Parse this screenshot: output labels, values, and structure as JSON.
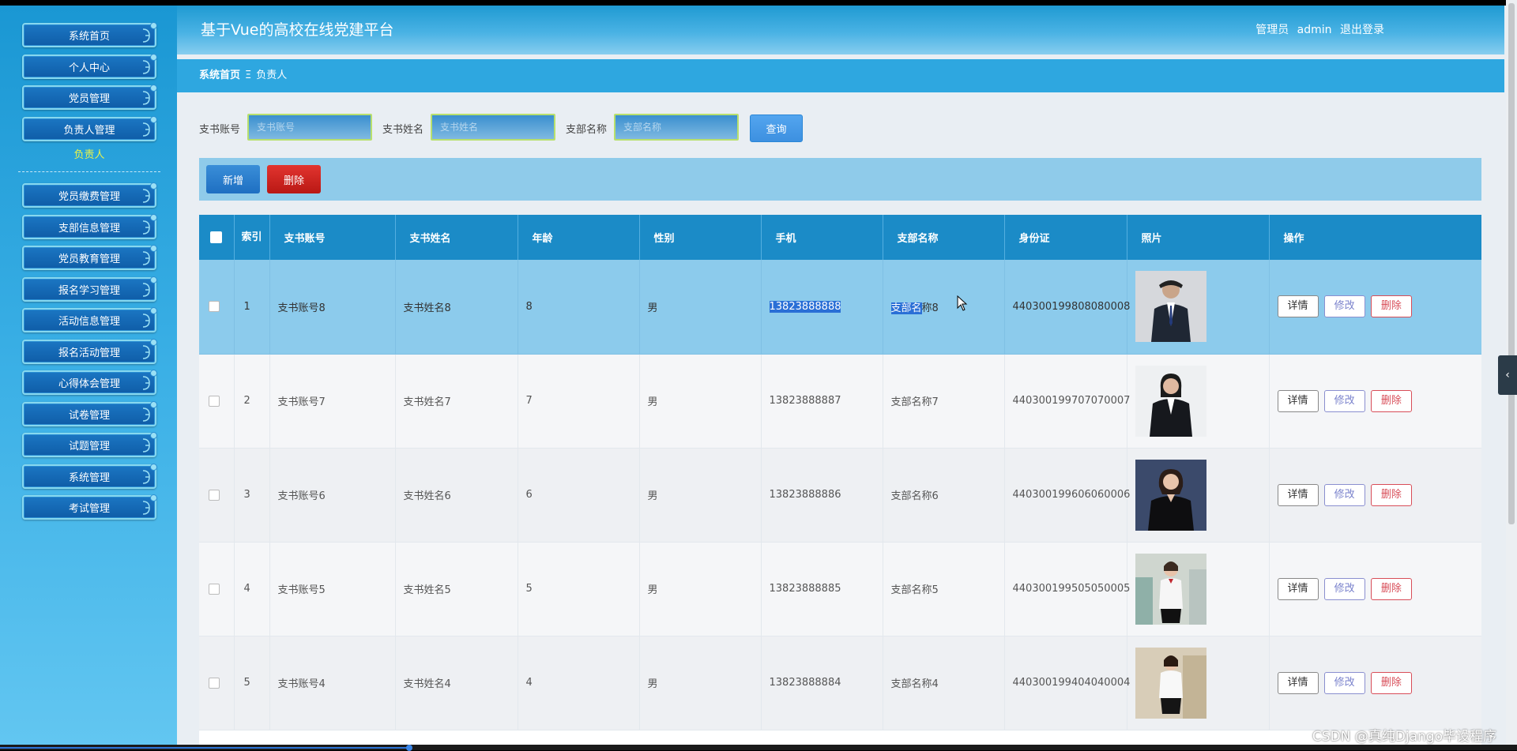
{
  "header": {
    "title": "基于Vue的高校在线党建平台",
    "user_role": "管理员",
    "user_name": "admin",
    "logout_label": "退出登录"
  },
  "sidebar": {
    "items": [
      {
        "label": "系统首页"
      },
      {
        "label": "个人中心"
      },
      {
        "label": "党员管理"
      },
      {
        "label": "负责人管理"
      }
    ],
    "active_subitem": "负责人",
    "items_after": [
      {
        "label": "党员缴费管理"
      },
      {
        "label": "支部信息管理"
      },
      {
        "label": "党员教育管理"
      },
      {
        "label": "报名学习管理"
      },
      {
        "label": "活动信息管理"
      },
      {
        "label": "报名活动管理"
      },
      {
        "label": "心得体会管理"
      },
      {
        "label": "试卷管理"
      },
      {
        "label": "试题管理"
      },
      {
        "label": "系统管理"
      },
      {
        "label": "考试管理"
      }
    ]
  },
  "breadcrumb": {
    "home": "系统首页",
    "separator": "Ξ",
    "current": "负责人"
  },
  "search": {
    "field1_label": "支书账号",
    "field1_placeholder": "支书账号",
    "field2_label": "支书姓名",
    "field2_placeholder": "支书姓名",
    "field3_label": "支部名称",
    "field3_placeholder": "支部名称",
    "query_label": "查询"
  },
  "actions": {
    "add_label": "新增",
    "delete_label": "删除"
  },
  "table": {
    "headers": {
      "index": "索引",
      "account": "支书账号",
      "name": "支书姓名",
      "age": "年龄",
      "gender": "性别",
      "phone": "手机",
      "branch": "支部名称",
      "id_card": "身份证",
      "photo": "照片",
      "ops": "操作"
    },
    "op_labels": {
      "detail": "详情",
      "edit": "修改",
      "delete": "删除"
    },
    "rows": [
      {
        "index": "1",
        "account": "支书账号8",
        "name": "支书姓名8",
        "age": "8",
        "gender": "男",
        "phone": "13823888888",
        "branch_selected_part": "支部名",
        "branch_rest": "称8",
        "id_card": "440300199808080008"
      },
      {
        "index": "2",
        "account": "支书账号7",
        "name": "支书姓名7",
        "age": "7",
        "gender": "男",
        "phone": "13823888887",
        "branch": "支部名称7",
        "id_card": "440300199707070007"
      },
      {
        "index": "3",
        "account": "支书账号6",
        "name": "支书姓名6",
        "age": "6",
        "gender": "男",
        "phone": "13823888886",
        "branch": "支部名称6",
        "id_card": "440300199606060006"
      },
      {
        "index": "4",
        "account": "支书账号5",
        "name": "支书姓名5",
        "age": "5",
        "gender": "男",
        "phone": "13823888885",
        "branch": "支部名称5",
        "id_card": "440300199505050005"
      },
      {
        "index": "5",
        "account": "支书账号4",
        "name": "支书姓名4",
        "age": "4",
        "gender": "男",
        "phone": "13823888884",
        "branch": "支部名称4",
        "id_card": "440300199404040004"
      }
    ]
  },
  "watermark": "CSDN @真纯Django毕设程序",
  "video_progress": 0.27,
  "colors": {
    "sidebar": "#2ea7e0",
    "header": "#49b2e4",
    "table_header": "#1b8bc7",
    "selected_row": "#8ccbec",
    "danger": "#c81e1a",
    "primary": "#2a7fd0"
  },
  "icons": {
    "cursor": "mouse-pointer-icon",
    "collapse": "chevron-left-icon",
    "ornament": "scroll-ornament-icon"
  }
}
